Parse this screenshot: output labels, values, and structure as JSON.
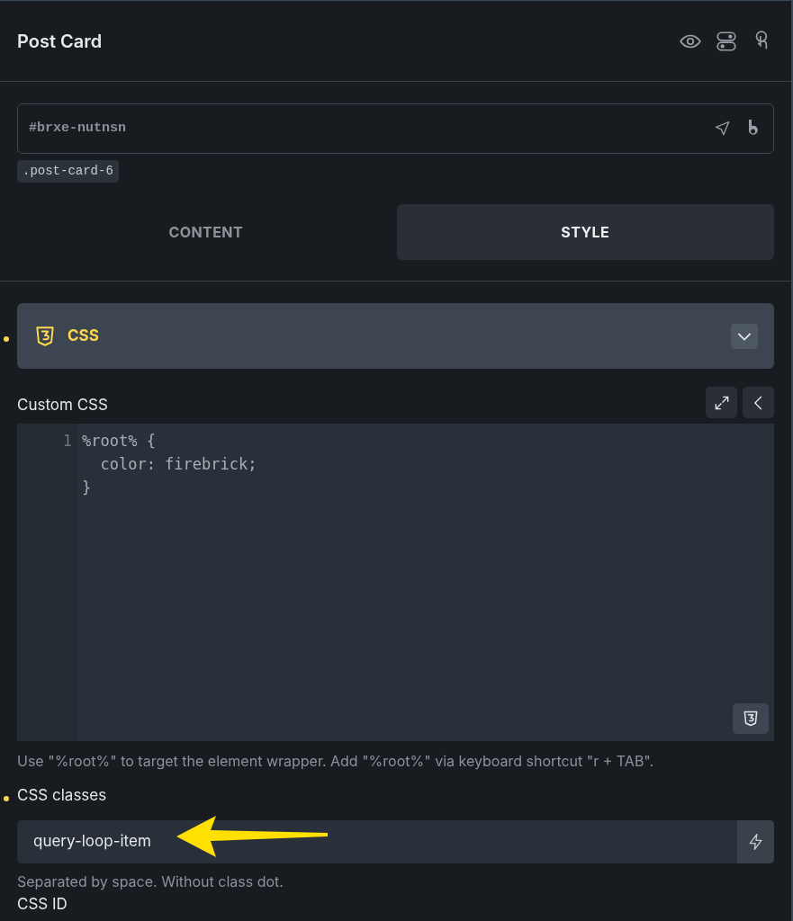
{
  "panel": {
    "title": "Post Card"
  },
  "element_id": {
    "value": "#brxe-nutnsn"
  },
  "class_tags": [
    ".post-card-6"
  ],
  "tabs": [
    {
      "label": "CONTENT",
      "selected": false
    },
    {
      "label": "STYLE",
      "selected": true
    }
  ],
  "section": {
    "title": "CSS",
    "modified": true,
    "expanded": true
  },
  "custom_css": {
    "label": "Custom CSS",
    "line_numbers": [
      "1"
    ],
    "lines": [
      "%root% {",
      "  color: firebrick;",
      "}"
    ],
    "hint": "Use \"%root%\" to target the element wrapper. Add \"%root%\" via keyboard shortcut \"r + TAB\"."
  },
  "css_classes": {
    "label": "CSS classes",
    "modified": true,
    "value": "query-loop-item",
    "hint": "Separated by space. Without class dot."
  },
  "css_id": {
    "label": "CSS ID"
  }
}
